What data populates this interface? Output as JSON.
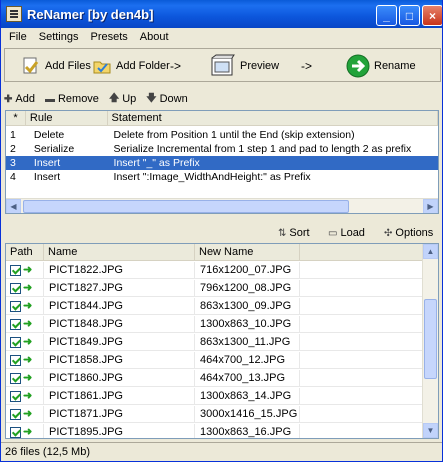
{
  "window": {
    "title": "ReNamer  [by den4b]"
  },
  "title_buttons": {
    "minimize": "_",
    "maximize": "□",
    "close": "×"
  },
  "menu": [
    "File",
    "Settings",
    "Presets",
    "About"
  ],
  "toolbar": {
    "add_files": "Add Files",
    "add_folder": "Add Folder",
    "arrow1": "->",
    "preview": "Preview",
    "arrow2": "->",
    "rename": "Rename"
  },
  "rules_toolbar": {
    "add": "Add",
    "remove": "Remove",
    "up": "Up",
    "down": "Down"
  },
  "rules_table": {
    "headers": [
      "*",
      "Rule",
      "Statement"
    ],
    "rows": [
      {
        "num": "1",
        "rule": "Delete",
        "statement": "Delete from Position 1 until the End (skip extension)",
        "selected": false
      },
      {
        "num": "2",
        "rule": "Serialize",
        "statement": "Serialize Incremental from 1 step 1 and pad to length 2 as prefix",
        "selected": false
      },
      {
        "num": "3",
        "rule": "Insert",
        "statement": "Insert \"_\" as Prefix",
        "selected": true
      },
      {
        "num": "4",
        "rule": "Insert",
        "statement": "Insert \":Image_WidthAndHeight:\" as Prefix",
        "selected": false
      }
    ]
  },
  "files_toolbar": {
    "sort": "Sort",
    "load": "Load",
    "options": "Options"
  },
  "files_table": {
    "headers": [
      "Path",
      "Name",
      "New Name"
    ],
    "rows": [
      {
        "name": "PICT1822.JPG",
        "new_name": "716x1200_07.JPG"
      },
      {
        "name": "PICT1827.JPG",
        "new_name": "796x1200_08.JPG"
      },
      {
        "name": "PICT1844.JPG",
        "new_name": "863x1300_09.JPG"
      },
      {
        "name": "PICT1848.JPG",
        "new_name": "1300x863_10.JPG"
      },
      {
        "name": "PICT1849.JPG",
        "new_name": "863x1300_11.JPG"
      },
      {
        "name": "PICT1858.JPG",
        "new_name": "464x700_12.JPG"
      },
      {
        "name": "PICT1860.JPG",
        "new_name": "464x700_13.JPG"
      },
      {
        "name": "PICT1861.JPG",
        "new_name": "1300x863_14.JPG"
      },
      {
        "name": "PICT1871.JPG",
        "new_name": "3000x1416_15.JPG"
      },
      {
        "name": "PICT1895.JPG",
        "new_name": "1300x863_16.JPG"
      }
    ]
  },
  "status": {
    "text": "26 files (12,5 Mb)"
  }
}
